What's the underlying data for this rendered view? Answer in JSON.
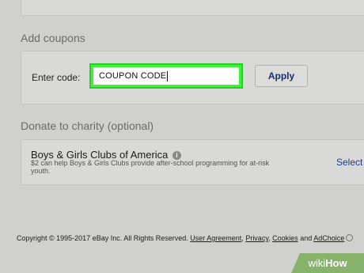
{
  "coupons": {
    "section_title": "Add coupons",
    "enter_label": "Enter code:",
    "input_value": "COUPON CODE",
    "apply_label": "Apply"
  },
  "charity": {
    "section_title": "Donate to charity (optional)",
    "name": "Boys & Girls Clubs of America",
    "info_glyph": "i",
    "description": "$2 can help Boys & Girls Clubs provide after-school programming for at-risk youth.",
    "select_label": "Select"
  },
  "footer": {
    "copyright": "Copyright © 1995-2017 eBay Inc. All Rights Reserved.",
    "links": [
      "User Agreement",
      "Privacy",
      "Cookies",
      "AdChoice"
    ],
    "and_word": "and"
  },
  "watermark": {
    "wiki": "wiki",
    "how": "How"
  },
  "colors": {
    "highlight": "#3ef23a",
    "link": "#1c2e6b",
    "background": "#d0d0ce"
  }
}
